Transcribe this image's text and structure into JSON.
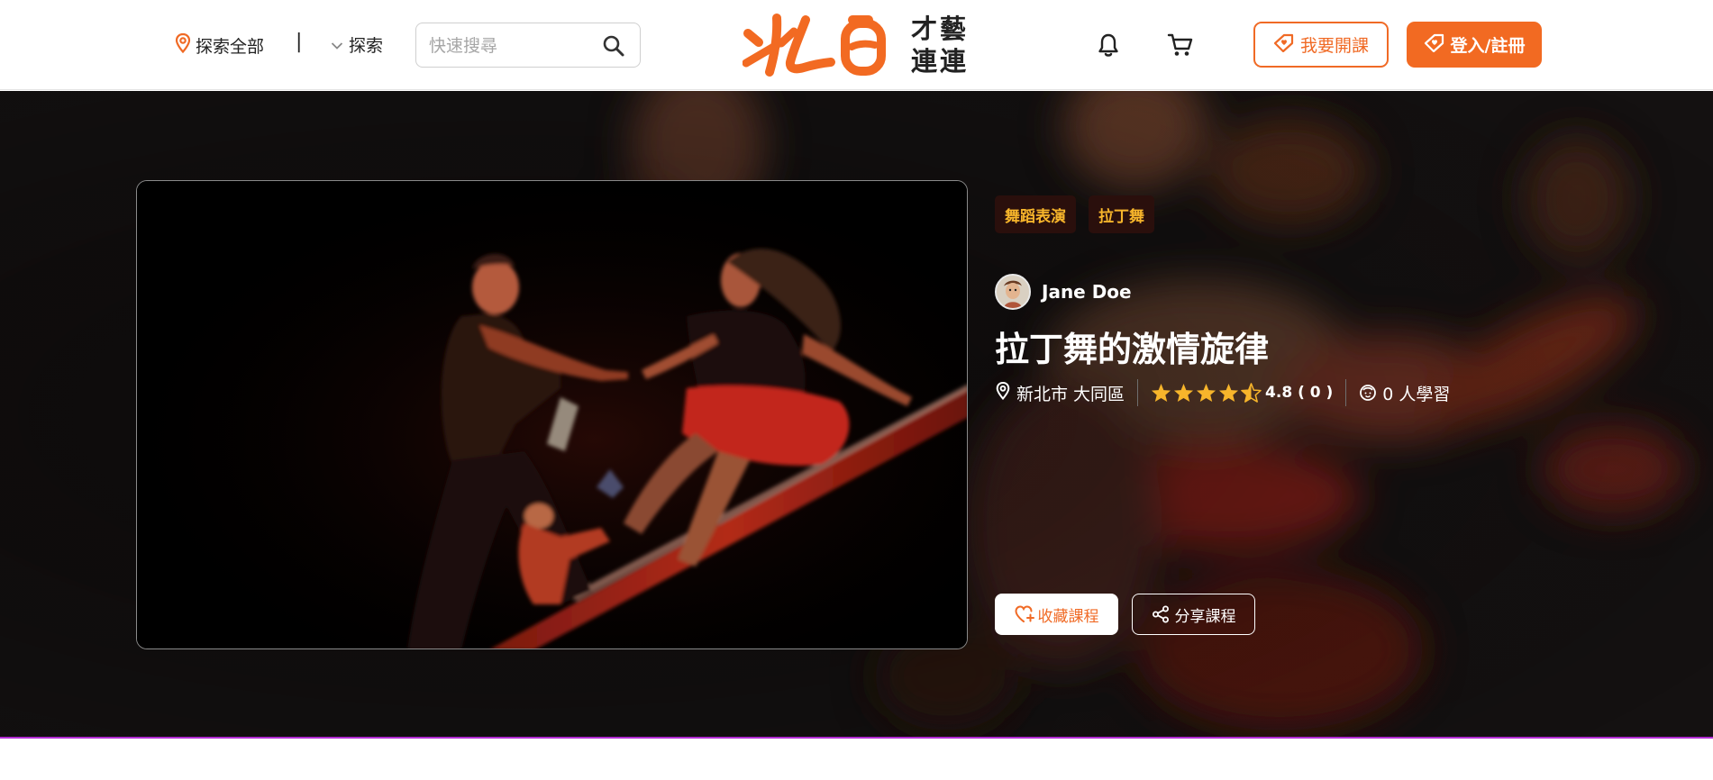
{
  "header": {
    "location_label": "探索全部",
    "separator": "|",
    "explore_label": "探索",
    "search": {
      "placeholder": "快速搜尋",
      "value": ""
    },
    "logo_text": [
      "才藝",
      "連連"
    ],
    "open_course_label": "我要開課",
    "login_label": "登入/註冊"
  },
  "course": {
    "tags": [
      "舞蹈表演",
      "拉丁舞"
    ],
    "teacher_name": "Jane Doe",
    "title": "拉丁舞的激情旋律",
    "location": "新北市 大同區",
    "rating": 4.8,
    "rating_text": "4.8 ( 0 )",
    "stars_display": 4.5,
    "learners_text": "0 人學習",
    "favorite_label": "收藏課程",
    "share_label": "分享課程"
  },
  "colors": {
    "brand_orange": "#f26a22",
    "tag_text": "#f7b52b",
    "hero_bg": "#141111",
    "star": "#f7b52b"
  },
  "icons": [
    "map-pin-icon",
    "chevron-down-icon",
    "search-icon",
    "bell-icon",
    "cart-icon",
    "tag-heart-icon",
    "star-icon",
    "star-half-icon",
    "learner-icon",
    "heart-plus-icon",
    "share-icon"
  ]
}
